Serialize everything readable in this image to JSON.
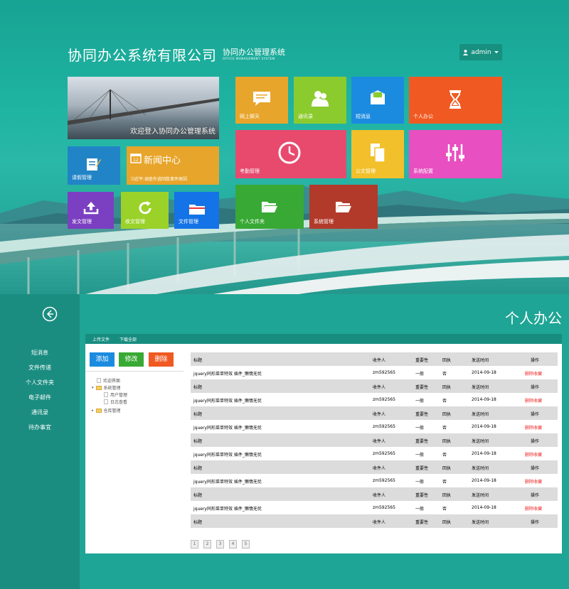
{
  "header": {
    "company": "协同办公系统有限公司",
    "system_cn": "协同办公管理系统",
    "system_en": "OFFICE MANAGEMENT SYSTEM",
    "user": "admin"
  },
  "tiles": {
    "welcome": "欢迎登入协同办公管理系统",
    "news_title": "新闻中心",
    "news_sub": "习近平:调查外逃回胜事件原因",
    "leave": "请假管理",
    "send_doc": "发文管理",
    "receive_doc": "收文管理",
    "file_mgmt": "文件管理",
    "chat": "网上聊天",
    "contacts": "通讯录",
    "sms": "短消息",
    "personal": "个人办公",
    "attendance": "考勤管理",
    "official_doc": "公文管理",
    "sys_config": "系统配置",
    "personal_folder": "个人文件夹",
    "sys_mgmt": "系统管理",
    "colors": {
      "chat": "#e8a52b",
      "contacts": "#8ccb2e",
      "sms": "#1b8be0",
      "personal": "#f05a22",
      "attendance": "#e84a6e",
      "official_doc": "#f1c02a",
      "sys_config": "#e84fc0",
      "personal_folder": "#39a935",
      "sys_mgmt": "#b23a2a",
      "leave": "#2184c6",
      "send_doc": "#7b3fc1",
      "receive_doc": "#9bd22a",
      "file_mgmt": "#1473e6"
    }
  },
  "sidebar": {
    "items": [
      "短消息",
      "文件传递",
      "个人文件夹",
      "电子邮件",
      "通讯录",
      "待办事宜"
    ]
  },
  "main": {
    "title": "个人办公",
    "toolbar": {
      "upload": "上传文件",
      "download_all": "下载全部"
    },
    "buttons": {
      "add": "添加",
      "edit": "修改",
      "delete": "删除"
    },
    "tree": {
      "welcome": "欢迎界面",
      "sys": "系统管理",
      "users": "用户管理",
      "logs": "日志查看",
      "warehouse": "仓库管理"
    },
    "table": {
      "headers": {
        "title": "标题",
        "receiver": "收件人",
        "importance": "重要性",
        "receipt": "回执",
        "time": "发送时间",
        "ops": "操作"
      },
      "row": {
        "title": "jquery同形菜单特效 插件_懒惰无忧",
        "receiver": "zm592565",
        "importance": "一般",
        "receipt": "否",
        "time": "2014-09-18",
        "del": "删除",
        "collect": "收藏"
      }
    },
    "pages": [
      "1",
      "2",
      "3",
      "4",
      "5"
    ]
  }
}
